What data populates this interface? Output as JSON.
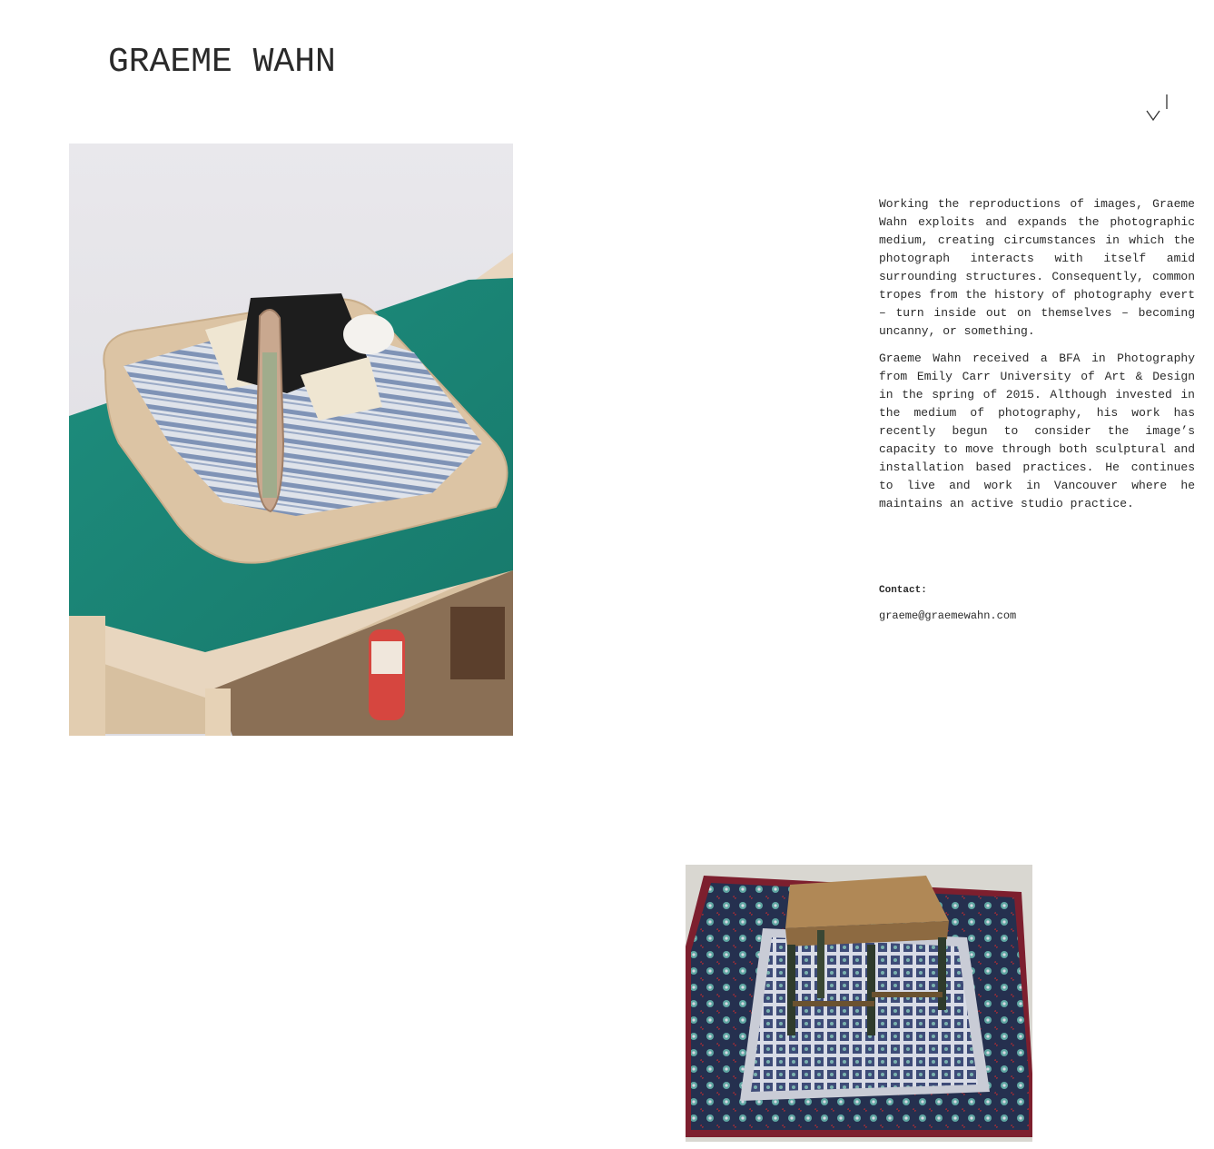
{
  "site": {
    "title": "GRAEME WAHN",
    "menu_icon": "chevron-menu-icon"
  },
  "bio": {
    "paragraph_1": "Working the reproductions of images, Graeme Wahn exploits and expands the photographic medium, creating circumstances in which the photograph interacts with itself amid surrounding structures. Consequently, common tropes from the history of photography evert – turn inside out on themselves – becoming uncanny, or something.",
    "paragraph_2": "Graeme Wahn received a BFA in Photography from Emily Carr University of Art & Design in the spring of 2015. Although invested in the medium of photography, his work has recently begun to consider the image’s capacity to move through both sculptural and installation based practices. He continues to live and work in Vancouver where he maintains an active studio practice."
  },
  "contact": {
    "label": "Contact:",
    "email": "graeme@graemewahn.com"
  },
  "colors": {
    "text": "#2a2a2a",
    "background": "#ffffff"
  }
}
